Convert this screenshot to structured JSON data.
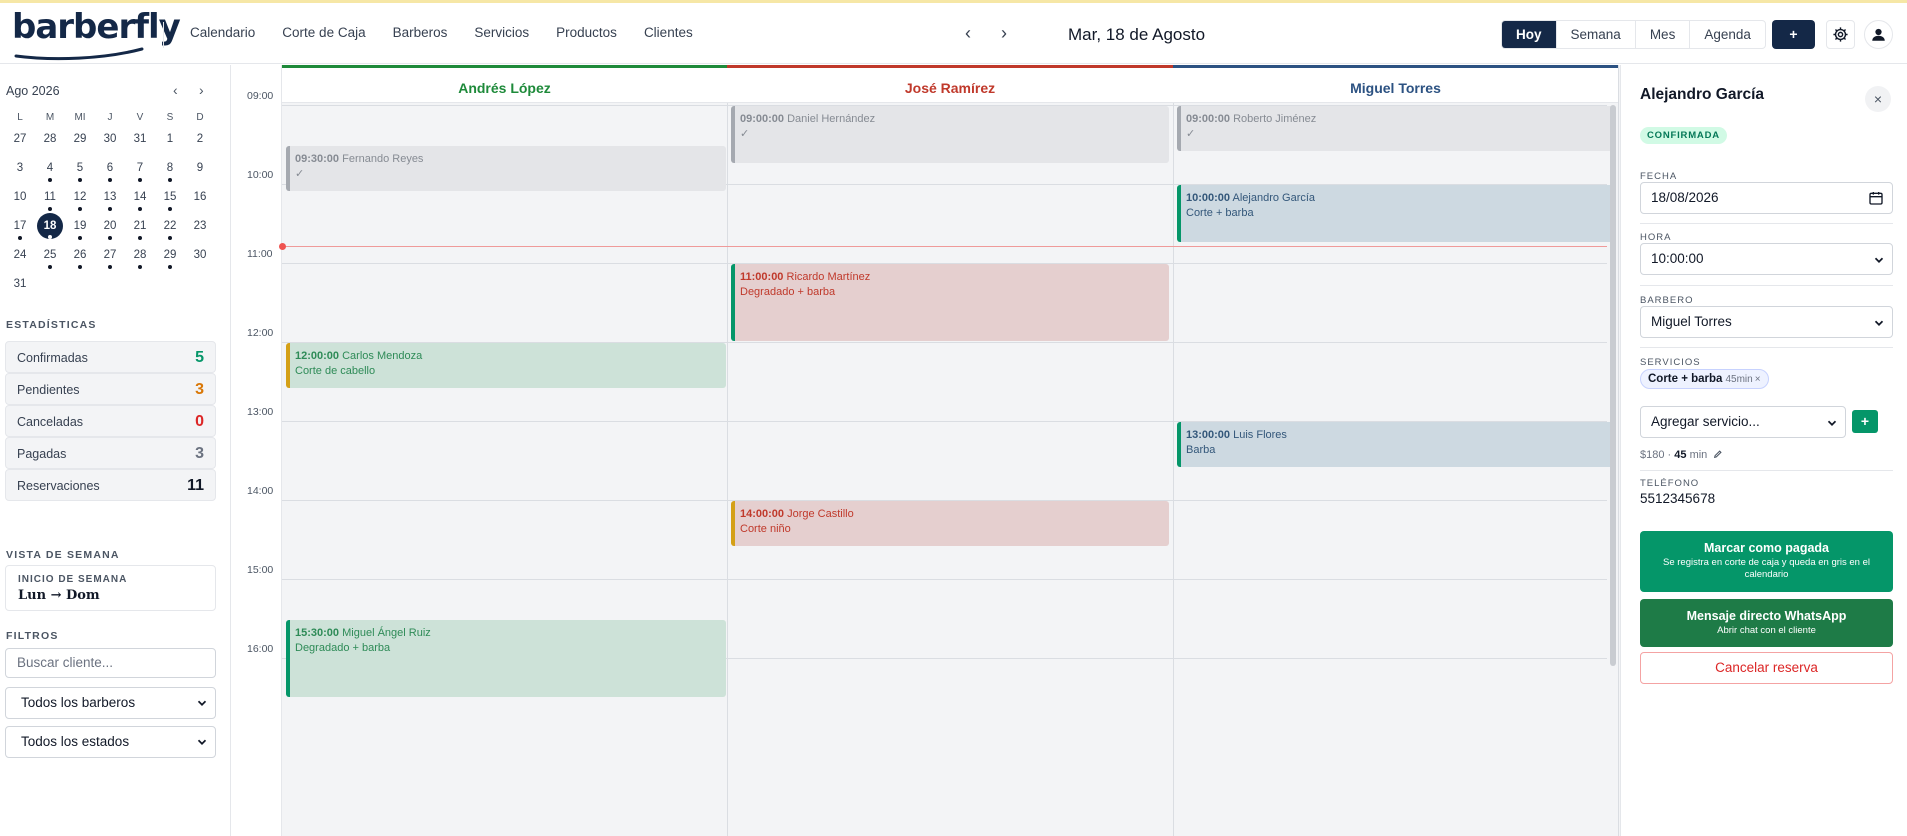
{
  "app": {
    "logo": "barberfly"
  },
  "nav": [
    "Calendario",
    "Corte de Caja",
    "Barberos",
    "Servicios",
    "Productos",
    "Clientes"
  ],
  "date_nav": {
    "prev": "‹",
    "next": "›",
    "label": "Mar, 18 de Agosto"
  },
  "views": {
    "today": "Hoy",
    "week": "Semana",
    "month": "Mes",
    "agenda": "Agenda"
  },
  "plus_label": "+",
  "mini_calendar": {
    "title": "Ago 2026",
    "prev": "‹",
    "next": "›",
    "weekdays": [
      "L",
      "M",
      "MI",
      "J",
      "V",
      "S",
      "D"
    ],
    "weeks": [
      [
        "27",
        "28",
        "29",
        "30",
        "31",
        "1",
        "2"
      ],
      [
        "3",
        "4",
        "5",
        "6",
        "7",
        "8",
        "9"
      ],
      [
        "10",
        "11",
        "12",
        "13",
        "14",
        "15",
        "16"
      ],
      [
        "17",
        "18",
        "19",
        "20",
        "21",
        "22",
        "23"
      ],
      [
        "24",
        "25",
        "26",
        "27",
        "28",
        "29",
        "30"
      ],
      [
        "31"
      ]
    ],
    "today": "18",
    "days_with_events": [
      "4",
      "5",
      "6",
      "7",
      "8",
      "11",
      "12",
      "13",
      "14",
      "15",
      "17",
      "18",
      "19",
      "20",
      "21",
      "22",
      "25",
      "26",
      "27",
      "28",
      "29"
    ]
  },
  "stats": {
    "title": "ESTADÍSTICAS",
    "items": [
      {
        "label": "Confirmadas",
        "value": "5",
        "color": "#059669"
      },
      {
        "label": "Pendientes",
        "value": "3",
        "color": "#d97706"
      },
      {
        "label": "Canceladas",
        "value": "0",
        "color": "#dc2626"
      },
      {
        "label": "Pagadas",
        "value": "3",
        "color": "#6b7280"
      },
      {
        "label": "Reservaciones",
        "value": "11",
        "color": "#111827"
      }
    ]
  },
  "week_view": {
    "title": "VISTA DE SEMANA",
    "caption": "INICIO DE SEMANA",
    "value": "Lun → Dom"
  },
  "filters": {
    "title": "FILTROS",
    "search_placeholder": "Buscar cliente...",
    "barbers_select": "Todos los barberos",
    "status_select": "Todos los estados"
  },
  "time_labels": [
    "09:00",
    "10:00",
    "11:00",
    "12:00",
    "13:00",
    "14:00",
    "15:00",
    "16:00"
  ],
  "barbers": [
    {
      "name": "Andrés López",
      "color": "#1e8a3a"
    },
    {
      "name": "José Ramírez",
      "color": "#c0392b"
    },
    {
      "name": "Miguel Torres",
      "color": "#2c5282"
    }
  ],
  "appointments": [
    {
      "col": 0,
      "time": "09:30:00",
      "client": "Fernando Reyes",
      "detail": "✓",
      "style": "gray",
      "accent": "#a5a9b0",
      "start": 9.5,
      "end": 10.1
    },
    {
      "col": 0,
      "time": "12:00:00",
      "client": "Carlos Mendoza",
      "detail": "Corte de cabello",
      "style": "green",
      "accent": "#d4a017",
      "start": 12.0,
      "end": 12.6
    },
    {
      "col": 0,
      "time": "15:30:00",
      "client": "Miguel Ángel Ruiz",
      "detail": "Degradado + barba",
      "style": "green",
      "accent": "#059669",
      "start": 15.5,
      "end": 16.5
    },
    {
      "col": 1,
      "time": "09:00:00",
      "client": "Daniel Hernández",
      "detail": "✓",
      "style": "gray",
      "accent": "#a5a9b0",
      "start": 9.0,
      "end": 9.75
    },
    {
      "col": 1,
      "time": "11:00:00",
      "client": "Ricardo Martínez",
      "detail": "Degradado + barba",
      "style": "red",
      "accent": "#059669",
      "start": 11.0,
      "end": 12.0
    },
    {
      "col": 1,
      "time": "14:00:00",
      "client": "Jorge Castillo",
      "detail": "Corte niño",
      "style": "red",
      "accent": "#d4a017",
      "start": 14.0,
      "end": 14.6
    },
    {
      "col": 2,
      "time": "09:00:00",
      "client": "Roberto Jiménez",
      "detail": "✓",
      "style": "gray",
      "accent": "#a5a9b0",
      "start": 9.0,
      "end": 9.6
    },
    {
      "col": 2,
      "time": "10:00:00",
      "client": "Alejandro García",
      "detail": "Corte + barba",
      "style": "blue",
      "accent": "#059669",
      "start": 10.0,
      "end": 10.75
    },
    {
      "col": 2,
      "time": "13:00:00",
      "client": "Luis Flores",
      "detail": "Barba",
      "style": "blue",
      "accent": "#059669",
      "start": 13.0,
      "end": 13.6
    }
  ],
  "panel": {
    "client_name": "Alejandro García",
    "close": "×",
    "status_badge": "CONFIRMADA",
    "date_caption": "FECHA",
    "date_value": "18/08/2026",
    "time_caption": "HORA",
    "time_value": "10:00:00",
    "barber_caption": "BARBERO",
    "barber_value": "Miguel Torres",
    "services_caption": "SERVICIOS",
    "service_chip": "Corte + barba",
    "service_minutes": "45min",
    "service_remove": "×",
    "add_service": "Agregar servicio...",
    "add_button": "+",
    "price": "$180 ·",
    "duration_value": "45",
    "duration_unit": "min",
    "phone_caption": "TELÉFONO",
    "phone": "5512345678",
    "mark_paid_title": "Marcar como pagada",
    "mark_paid_sub": "Se registra en corte de caja y queda en gris en el calendario",
    "mark_paid_color": "#059669",
    "whatsapp_title": "Mensaje directo WhatsApp",
    "whatsapp_sub": "Abrir chat con el cliente",
    "whatsapp_color": "#1e7b47",
    "cancel": "Cancelar reserva"
  }
}
